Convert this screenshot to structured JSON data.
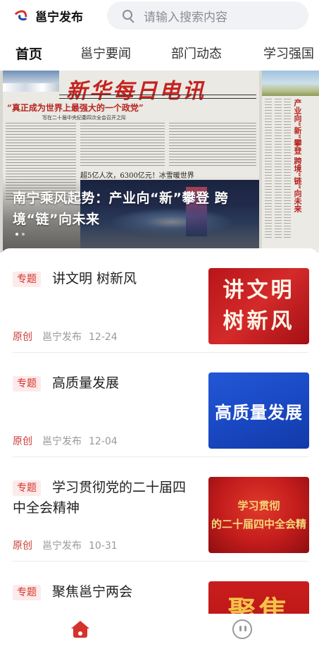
{
  "header": {
    "app_name": "邕宁发布",
    "search_placeholder": "请输入搜索内容"
  },
  "tabs": [
    {
      "label": "首页",
      "active": true
    },
    {
      "label": "邕宁要闻",
      "active": false
    },
    {
      "label": "部门动态",
      "active": false
    },
    {
      "label": "学习强国",
      "active": false
    }
  ],
  "banner": {
    "caption": "南宁乘风起势：产业向“新”攀登 跨境“链”向未来",
    "slide_count": 2,
    "active_slide": 1,
    "newspaper": {
      "masthead": "新华每日电讯",
      "headline": "“真正成为世界上最强大的一个政党”",
      "subhead": "写在二十届中央纪委四次全会召开之际",
      "mid_line": "超5亿人次，6300亿元！冰雪暖世界",
      "side_headline": "产业向“新”攀登 跨境“链”向未来"
    }
  },
  "feed": [
    {
      "tag": "专题",
      "title": "讲文明 树新风",
      "origin": "原创",
      "source": "邕宁发布",
      "date": "12-24",
      "thumb_text": "讲文明\n树新风"
    },
    {
      "tag": "专题",
      "title": "高质量发展",
      "origin": "原创",
      "source": "邕宁发布",
      "date": "12-04",
      "thumb_text": "高质量发展"
    },
    {
      "tag": "专题",
      "title": "学习贯彻党的二十届四中全会精神",
      "origin": "原创",
      "source": "邕宁发布",
      "date": "10-31",
      "thumb_text_line1": "学习贯彻",
      "thumb_text_line2": "的二十届四中全会精"
    },
    {
      "tag": "专题",
      "title": "聚焦邕宁两会",
      "thumb_text": "聚焦"
    }
  ],
  "colors": {
    "accent": "#d6322c",
    "tag_bg": "#fdeaea",
    "meta": "#999999",
    "search_bg": "#f1f2f5"
  },
  "bottom_nav": {
    "home_icon": "home-icon",
    "me_icon": "face-icon"
  }
}
